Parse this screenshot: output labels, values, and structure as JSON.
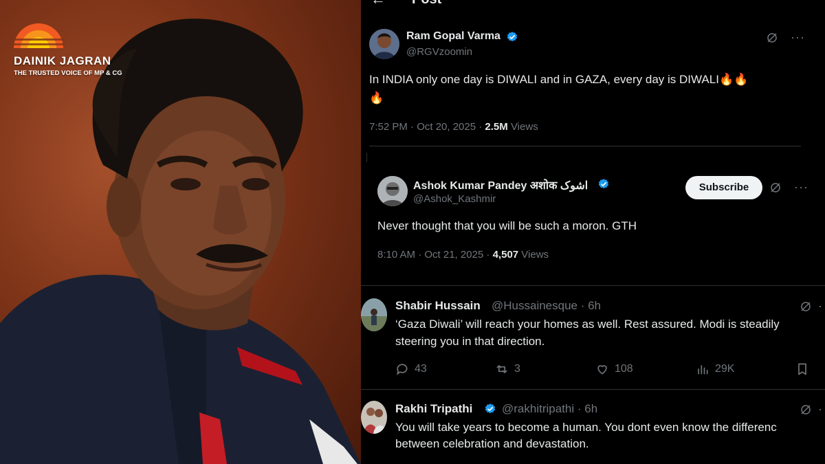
{
  "brand": {
    "name": "DAINIK JAGRAN",
    "tagline": "THE TRUSTED VOICE OF MP & CG"
  },
  "topbar": {
    "back_icon": "back-arrow-icon",
    "title": "Post"
  },
  "main_tweet": {
    "author_name": "Ram Gopal Varma",
    "author_handle": "@RGVzoomin",
    "verified": true,
    "text_line1": "In INDIA only one day is DIWALI and in GAZA, every day is DIWALI🔥🔥",
    "text_line2": "🔥",
    "time": "7:52 PM · Oct 20, 2025 · ",
    "views_count": "2.5M",
    "views_label": " Views"
  },
  "quote_tweet": {
    "author_name": "Ashok Kumar Pandey अशोक اشوک",
    "author_handle": "@Ashok_Kashmir",
    "verified": true,
    "subscribe_label": "Subscribe",
    "text": "Never thought that you will be such a moron. GTH",
    "time": "8:10 AM · Oct 21, 2025 · ",
    "views_count": "4,507",
    "views_label": " Views"
  },
  "replies": [
    {
      "author_name": "Shabir Hussain",
      "author_handle": "@Hussainesque · 6h",
      "verified": false,
      "text_line1": "‘Gaza Diwali’ will reach your homes as well. Rest assured. Modi is steadily",
      "text_line2": "steering you in that direction.",
      "replies": "43",
      "reposts": "3",
      "likes": "108",
      "views": "29K"
    },
    {
      "author_name": "Rakhi Tripathi",
      "author_handle": "@rakhitripathi · 6h",
      "verified": true,
      "text_line1": "You will take years to become a human. You dont even know the differenc",
      "text_line2": "between celebration and devastation."
    }
  ],
  "colors": {
    "background": "#000000",
    "text_primary": "#e7e9ea",
    "text_secondary": "#71767b",
    "verified_blue": "#1d9bf0",
    "divider": "#2f3336",
    "brand_orange": "#f15a22"
  }
}
